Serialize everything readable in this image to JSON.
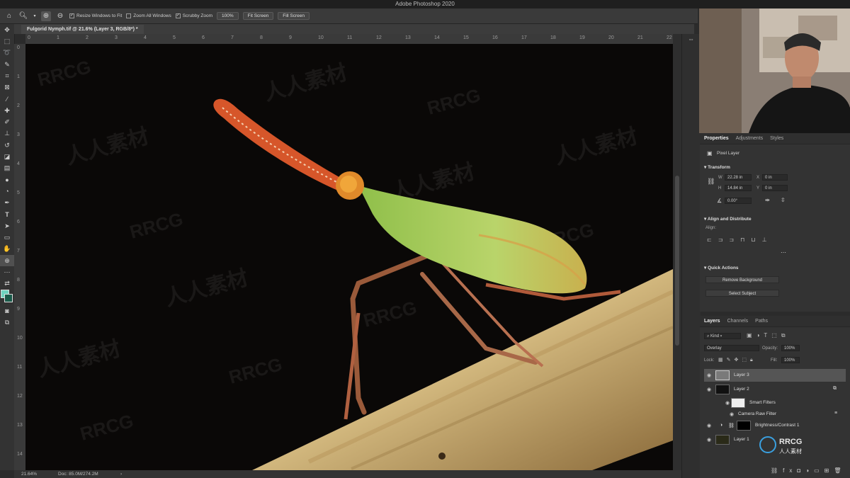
{
  "app": {
    "title": "Adobe Photoshop 2020"
  },
  "options_bar": {
    "resize_windows_label": "Resize Windows to Fit",
    "zoom_all_windows_label": "Zoom All Windows",
    "scrubby_zoom_label": "Scrubby Zoom",
    "zoom_100_label": "100%",
    "fit_screen_label": "Fit Screen",
    "fill_screen_label": "Fill Screen"
  },
  "document": {
    "tab_title": "Fulgorid Nymph.tif @ 21.6% (Layer 3, RGB/8*) *",
    "zoom_status": "21.64%",
    "doc_status": "Doc: 85.0M/274.2M"
  },
  "rulers": {
    "horizontal": [
      "0",
      "1",
      "2",
      "3",
      "4",
      "5",
      "6",
      "7",
      "8",
      "9",
      "10",
      "11",
      "12",
      "13",
      "14",
      "15",
      "16",
      "17",
      "18",
      "19",
      "20",
      "21",
      "22"
    ],
    "vertical": [
      "0",
      "1",
      "2",
      "3",
      "4",
      "5",
      "6",
      "7",
      "8",
      "9",
      "10",
      "11",
      "12",
      "13",
      "14"
    ]
  },
  "properties": {
    "tabs": [
      "Properties",
      "Adjustments",
      "Styles"
    ],
    "active_tab": "Properties",
    "layer_type": "Pixel Layer",
    "transform": {
      "title": "Transform",
      "w_label": "W",
      "w_value": "22.28 in",
      "h_label": "H",
      "h_value": "14.84 in",
      "x_label": "X",
      "x_value": "0 in",
      "y_label": "Y",
      "y_value": "0 in",
      "angle_value": "0.00°"
    },
    "align": {
      "title": "Align and Distribute",
      "subtitle": "Align:"
    },
    "quick_actions": {
      "title": "Quick Actions",
      "remove_bg_label": "Remove Background",
      "select_subject_label": "Select Subject"
    }
  },
  "layers_panel": {
    "tabs": [
      "Layers",
      "Channels",
      "Paths"
    ],
    "active_tab": "Layers",
    "kind_label": "Kind",
    "blend_mode": "Overlay",
    "opacity_label": "Opacity:",
    "opacity_value": "100%",
    "lock_label": "Lock:",
    "fill_label": "Fill:",
    "fill_value": "100%",
    "layers": [
      {
        "name": "Layer 3"
      },
      {
        "name": "Layer 2"
      },
      {
        "name": "Smart Filters"
      },
      {
        "name": "Camera Raw Filter"
      },
      {
        "name": "Brightness/Contrast 1"
      },
      {
        "name": "Layer 1"
      }
    ]
  },
  "watermark": {
    "text1": "RRCG",
    "text2": "人人素材"
  },
  "colors": {
    "foreground": "#6fd3c0",
    "background": "#1a5a4a",
    "panel_bg": "#333333"
  }
}
